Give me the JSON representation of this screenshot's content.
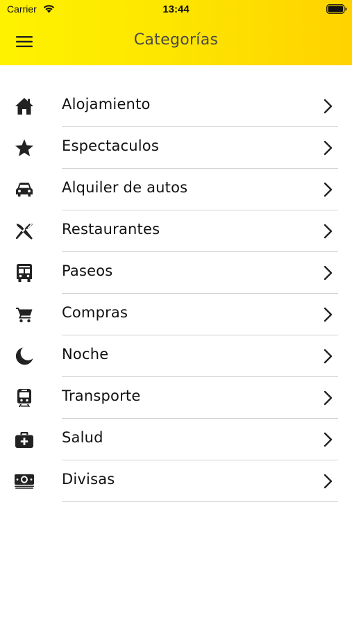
{
  "status_bar": {
    "carrier": "Carrier",
    "time": "13:44"
  },
  "header": {
    "title": "Categorías",
    "menu_icon": "hamburger-menu-icon",
    "gradient": [
      "#fff200",
      "#ffd200"
    ]
  },
  "categories": [
    {
      "label": "Alojamiento",
      "icon": "home-icon"
    },
    {
      "label": "Espectaculos",
      "icon": "star-icon"
    },
    {
      "label": "Alquiler de autos",
      "icon": "car-icon"
    },
    {
      "label": "Restaurantes",
      "icon": "utensils-icon"
    },
    {
      "label": "Paseos",
      "icon": "bus-icon"
    },
    {
      "label": "Compras",
      "icon": "cart-icon"
    },
    {
      "label": "Noche",
      "icon": "moon-icon"
    },
    {
      "label": "Transporte",
      "icon": "train-icon"
    },
    {
      "label": "Salud",
      "icon": "medical-kit-icon"
    },
    {
      "label": "Divisas",
      "icon": "money-icon"
    }
  ]
}
